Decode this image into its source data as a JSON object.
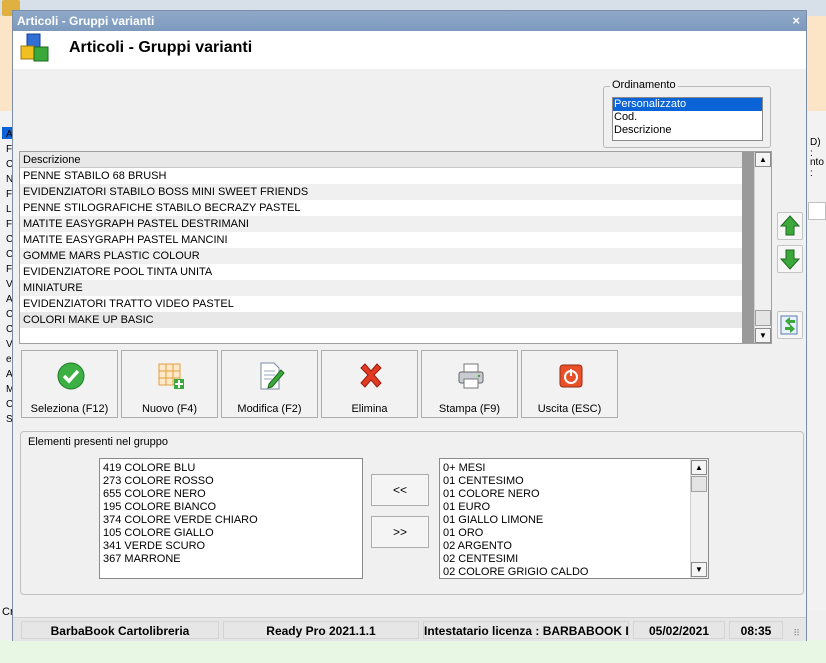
{
  "window": {
    "title": "Articoli - Gruppi varianti",
    "close_glyph": "×",
    "header_title": "Articoli - Gruppi varianti",
    "header_icon": "cubes-icon"
  },
  "ordering": {
    "legend": "Ordinamento",
    "options": [
      "Personalizzato",
      "Cod.",
      "Descrizione"
    ],
    "selected": "Personalizzato"
  },
  "groups_list": {
    "column_header": "Descrizione",
    "rows": [
      "PENNE STABILO 68 BRUSH",
      "EVIDENZIATORI STABILO BOSS MINI SWEET FRIENDS",
      "PENNE STILOGRAFICHE STABILO BECRAZY PASTEL",
      "MATITE EASYGRAPH PASTEL DESTRIMANI",
      "MATITE EASYGRAPH PASTEL MANCINI",
      "GOMME MARS PLASTIC COLOUR",
      "EVIDENZIATORE POOL TINTA UNITA",
      "MINIATURE",
      "EVIDENZIATORI TRATTO VIDEO PASTEL",
      "COLORI MAKE UP BASIC"
    ],
    "selected_row": "COLORI MAKE UP BASIC"
  },
  "side_buttons": [
    "arrow-up-icon",
    "arrow-down-icon",
    "refresh-icon"
  ],
  "actions": [
    {
      "label": "Seleziona (F12)",
      "icon": "check-icon"
    },
    {
      "label": "Nuovo (F4)",
      "icon": "grid-add-icon"
    },
    {
      "label": "Modifica (F2)",
      "icon": "edit-document-icon"
    },
    {
      "label": "Elimina",
      "icon": "delete-x-icon"
    },
    {
      "label": "Stampa (F9)",
      "icon": "printer-icon"
    },
    {
      "label": "Uscita (ESC)",
      "icon": "power-exit-icon"
    }
  ],
  "elements": {
    "legend": "Elementi presenti nel gruppo",
    "in_group": [
      "419 COLORE BLU",
      "273 COLORE ROSSO",
      "655 COLORE NERO",
      "195 COLORE BIANCO",
      "374 COLORE VERDE CHIARO",
      "105 COLORE GIALLO",
      "341 VERDE SCURO",
      "367 MARRONE"
    ],
    "available": [
      "0+ MESI",
      "01 CENTESIMO",
      "01 COLORE NERO",
      "01 EURO",
      "01 GIALLO LIMONE",
      "01 ORO",
      "02 ARGENTO",
      "02 CENTESIMI",
      "02 COLORE GRIGIO CALDO"
    ],
    "add_button": "<<",
    "remove_button": ">>"
  },
  "status_bar": {
    "company": "BarbaBook Cartolibreria",
    "version": "Ready Pro 2021.1.1",
    "license": "Intestatario licenza : BARBABOOK D",
    "date": "05/02/2021",
    "time": "08:35"
  },
  "background": {
    "left_letters": [
      "A",
      "F",
      "C",
      "N",
      "F",
      "L",
      "F",
      "C",
      "C",
      "F",
      "V",
      "A",
      "C",
      "C",
      "V",
      "e",
      "A",
      "M",
      "C",
      "S"
    ],
    "right_texts": [
      "D) :",
      "nto :"
    ],
    "bottom_left": "Cr"
  },
  "colors": {
    "titlebar": "#7d9abd",
    "selection": "#0a64d8",
    "green_arrow": "#3aa83a",
    "orange_bg": "#fce4c7"
  }
}
